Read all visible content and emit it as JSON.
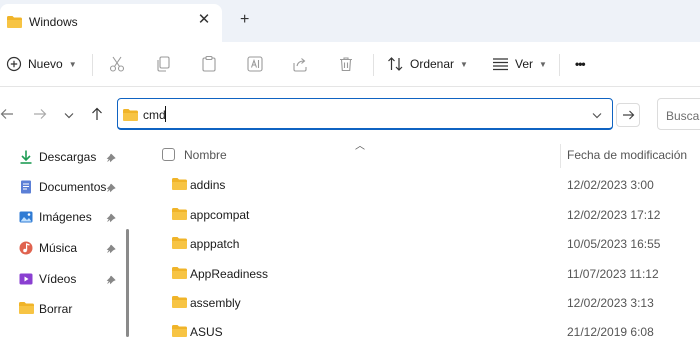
{
  "tab": {
    "title": "Windows",
    "close": "✕",
    "new_tab": "+"
  },
  "toolbar": {
    "new_label": "Nuevo",
    "sort_label": "Ordenar",
    "view_label": "Ver",
    "more": "•••"
  },
  "address": {
    "value": "cmd"
  },
  "search": {
    "placeholder": "Buscar"
  },
  "sidebar": {
    "items": [
      {
        "label": "Descargas",
        "icon": "download-icon"
      },
      {
        "label": "Documentos",
        "icon": "document-icon"
      },
      {
        "label": "Imágenes",
        "icon": "pictures-icon"
      },
      {
        "label": "Música",
        "icon": "music-icon"
      },
      {
        "label": "Vídeos",
        "icon": "video-icon"
      },
      {
        "label": "Borrar",
        "icon": "folder-icon"
      }
    ]
  },
  "columns": {
    "name": "Nombre",
    "date": "Fecha de modificación"
  },
  "files": [
    {
      "name": "addins",
      "date": "12/02/2023 3:00"
    },
    {
      "name": "appcompat",
      "date": "12/02/2023 17:12"
    },
    {
      "name": "apppatch",
      "date": "10/05/2023 16:55"
    },
    {
      "name": "AppReadiness",
      "date": "11/07/2023 11:12"
    },
    {
      "name": "assembly",
      "date": "12/02/2023 3:13"
    },
    {
      "name": "ASUS",
      "date": "21/12/2019 6:08"
    }
  ],
  "colors": {
    "accent": "#0f63c2",
    "folder": "#f7c444",
    "tabbar": "#eef2f8"
  }
}
